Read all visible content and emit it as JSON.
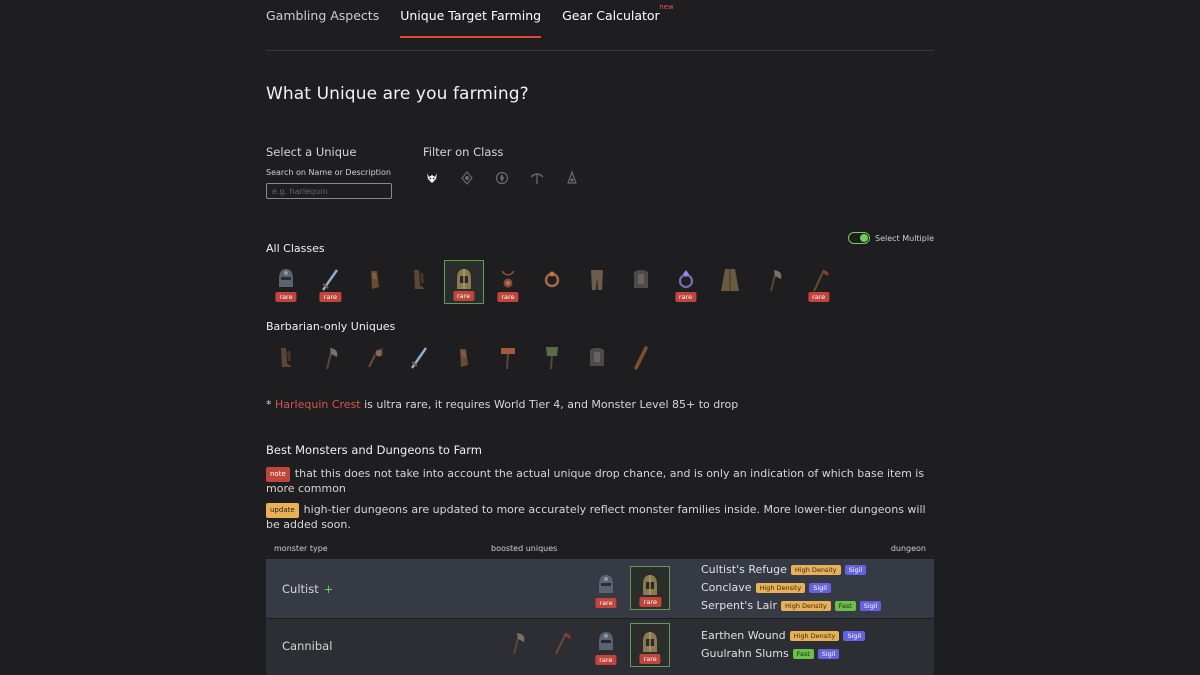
{
  "tabs": [
    {
      "label": "Gambling Aspects"
    },
    {
      "label": "Unique Target Farming"
    },
    {
      "label": "Gear Calculator",
      "badge": "new"
    }
  ],
  "page_title": "What Unique are you farming?",
  "select": {
    "label": "Select a Unique",
    "search_label": "Search on Name or Description",
    "placeholder": "e.g. harlequin"
  },
  "filter": {
    "label": "Filter on Class",
    "classes": [
      "barbarian-icon",
      "druid-icon",
      "necromancer-icon",
      "rogue-icon",
      "sorcerer-icon"
    ]
  },
  "toggle": {
    "label": "Select Multiple",
    "checked": true
  },
  "all_classes": {
    "heading": "All Classes",
    "items": [
      {
        "icon": "helm-icon",
        "rare": "rare"
      },
      {
        "icon": "sword-icon",
        "rare": "rare"
      },
      {
        "icon": "gloves-icon"
      },
      {
        "icon": "boots-icon"
      },
      {
        "icon": "crest-helm-icon",
        "rare": "rare",
        "selected": true
      },
      {
        "icon": "amulet-icon",
        "rare": "rare"
      },
      {
        "icon": "ring-icon"
      },
      {
        "icon": "leg-armor-icon"
      },
      {
        "icon": "chest-armor-icon"
      },
      {
        "icon": "gem-ring-icon",
        "rare": "rare"
      },
      {
        "icon": "cloak-icon"
      },
      {
        "icon": "axe-icon"
      },
      {
        "icon": "scythe-icon",
        "rare": "rare"
      }
    ]
  },
  "barbarian": {
    "heading": "Barbarian-only Uniques",
    "items": [
      {
        "icon": "boots-icon"
      },
      {
        "icon": "axe-icon"
      },
      {
        "icon": "flail-icon"
      },
      {
        "icon": "sword-icon"
      },
      {
        "icon": "gloves-icon"
      },
      {
        "icon": "hammer-icon"
      },
      {
        "icon": "mace-icon"
      },
      {
        "icon": "chest-armor-icon"
      },
      {
        "icon": "club-icon"
      }
    ]
  },
  "ultra_note": {
    "prefix": "* ",
    "item": "Harlequin Crest",
    "suffix": " is ultra rare, it requires World Tier 4, and Monster Level 85+ to drop"
  },
  "best": {
    "heading": "Best Monsters and Dungeons to Farm",
    "note_tag": "note",
    "note_text": "that this does not take into account the actual unique drop chance, and is only an indication of which base item is more common",
    "update_tag": "update",
    "update_text": "high-tier dungeons are updated to more accurately reflect monster families inside. More lower-tier dungeons will be added soon."
  },
  "table": {
    "headers": {
      "monster": "monster type",
      "boosted": "boosted uniques",
      "dungeon": "dungeon"
    },
    "rows": [
      {
        "monster": "Cultist",
        "plus": "+",
        "uniques": [
          {
            "icon": "helm-icon",
            "rare": "rare"
          },
          {
            "icon": "crest-helm-icon",
            "rare": "rare",
            "selected": true
          }
        ],
        "dungeons": [
          {
            "name": "Cultist's Refuge",
            "badges": [
              "High Density",
              "Sigil"
            ]
          },
          {
            "name": "Conclave",
            "badges": [
              "High Density",
              "Sigil"
            ]
          },
          {
            "name": "Serpent's Lair",
            "badges": [
              "High Density",
              "Fast",
              "Sigil"
            ]
          }
        ]
      },
      {
        "monster": "Cannibal",
        "uniques": [
          {
            "icon": "axe-icon"
          },
          {
            "icon": "scythe-icon"
          },
          {
            "icon": "helm-icon",
            "rare": "rare"
          },
          {
            "icon": "crest-helm-icon",
            "rare": "rare",
            "selected": true
          }
        ],
        "dungeons": [
          {
            "name": "Earthen Wound",
            "badges": [
              "High Density",
              "Sigil"
            ]
          },
          {
            "name": "Guulrahn Slums",
            "badges": [
              "Fast",
              "Sigil"
            ]
          }
        ]
      }
    ]
  },
  "colors": {
    "background": "#1e1e20",
    "accent_red": "#e04a3a",
    "rare_badge": "#c0463c",
    "high_density": "#e8b057",
    "sigil": "#6562e0",
    "fast": "#6cc04a",
    "toggle_green": "#6bcf5a",
    "row_highlight": "#353a45"
  }
}
